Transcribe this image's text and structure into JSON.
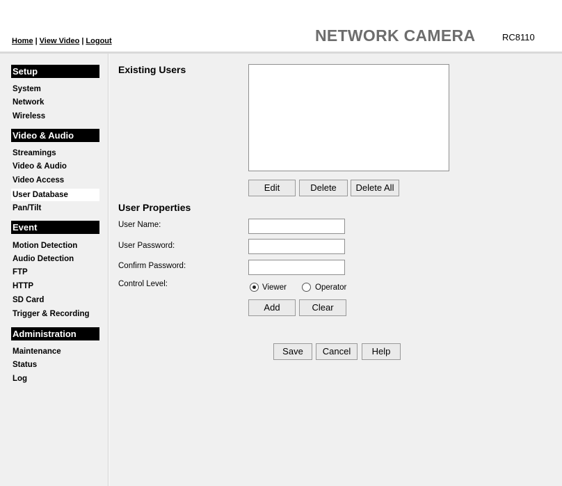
{
  "header": {
    "nav": [
      "Home",
      "View Video",
      "Logout"
    ],
    "brand": "NETWORK CAMERA",
    "model": "RC8110"
  },
  "sidebar": {
    "setup": {
      "title": "Setup",
      "items": [
        "System",
        "Network",
        "Wireless"
      ]
    },
    "video": {
      "title": "Video & Audio",
      "items": [
        "Streamings",
        "Video & Audio",
        "Video Access",
        "User Database",
        "Pan/Tilt"
      ]
    },
    "event": {
      "title": "Event",
      "items": [
        "Motion Detection",
        "Audio Detection",
        "FTP",
        "HTTP",
        "SD Card",
        "Trigger & Recording"
      ]
    },
    "admin": {
      "title": "Administration",
      "items": [
        "Maintenance",
        "Status",
        "Log"
      ]
    },
    "active": "User Database"
  },
  "main": {
    "existing_users_title": "Existing Users",
    "existing_users": [],
    "list_buttons": {
      "edit": "Edit",
      "delete": "Delete",
      "delete_all": "Delete All"
    },
    "user_properties_title": "User Properties",
    "user_name_label": "User Name:",
    "user_name_value": "",
    "user_password_label": "User Password:",
    "user_password_value": "",
    "confirm_password_label": "Confirm Password:",
    "confirm_password_value": "",
    "control_level_label": "Control Level:",
    "control_level_options": [
      "Viewer",
      "Operator"
    ],
    "control_level_selected": "Viewer",
    "form_buttons": {
      "add": "Add",
      "clear": "Clear"
    },
    "page_buttons": {
      "save": "Save",
      "cancel": "Cancel",
      "help": "Help"
    }
  }
}
